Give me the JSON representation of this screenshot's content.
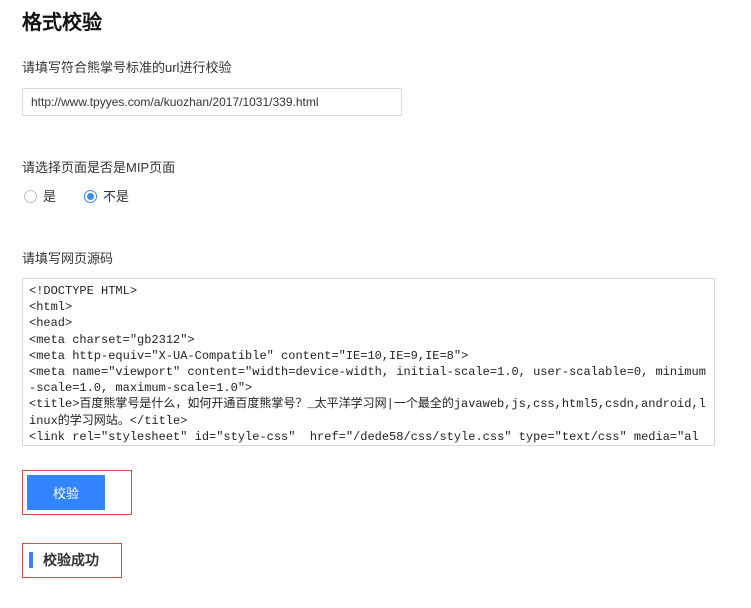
{
  "page": {
    "title": "格式校验"
  },
  "url_section": {
    "label": "请填写符合熊掌号标准的url进行校验",
    "input_value": "http://www.tpyyes.com/a/kuozhan/2017/1031/339.html"
  },
  "mip_section": {
    "label": "请选择页面是否是MIP页面",
    "options": {
      "yes": "是",
      "no": "不是"
    },
    "selected": "no"
  },
  "source_section": {
    "label": "请填写网页源码",
    "code": "<!DOCTYPE HTML>\n<html>\n<head>\n<meta charset=\"gb2312\">\n<meta http-equiv=\"X-UA-Compatible\" content=\"IE=10,IE=9,IE=8\">\n<meta name=\"viewport\" content=\"width=device-width, initial-scale=1.0, user-scalable=0, minimum-scale=1.0, maximum-scale=1.0\">\n<title>百度熊掌号是什么，如何开通百度熊掌号？_太平洋学习网|一个最全的javaweb,js,css,html5,csdn,android,linux的学习网站。</title>\n<link rel=\"stylesheet\" id=\"style-css\"  href=\"/dede58/css/style.css\" type=\"text/css\" media=\"all\" />\n<link rel=\"canonical\" href=\"http://www.tpyyes.com/a/kuozhan/2017/1031/339.html\"/>\n<meta name=\"keywords\" content=\"百度熊掌号,熊掌号\" />\n<meta name=\"description\" content=\"今天登陆百度站长平台,发现百度站长平台名称变成了百度资源平台,连域名都换了，还出现了“百度熊掌……"
  },
  "actions": {
    "submit_label": "校验"
  },
  "result": {
    "success_text": "校验成功"
  }
}
